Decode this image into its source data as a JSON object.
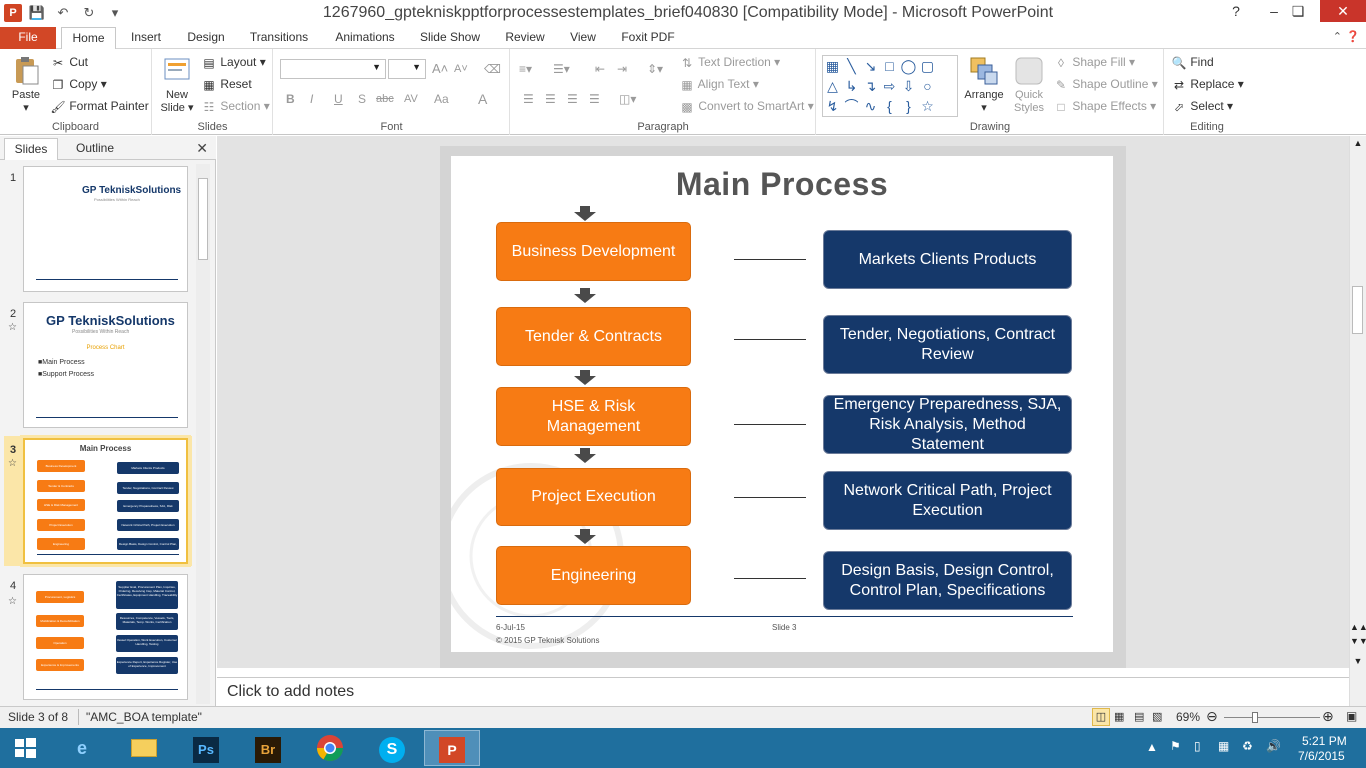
{
  "window": {
    "app_letter": "P",
    "title": "1267960_gpteknisk​pptforprocessestemplates_brief040830 [Compatibility Mode]  -  Microsoft PowerPoint",
    "help": "?",
    "minimize": "–",
    "restore": "❏",
    "close": "✕"
  },
  "tabs": [
    "File",
    "Home",
    "Insert",
    "Design",
    "Transitions",
    "Animations",
    "Slide Show",
    "Review",
    "View",
    "Foxit PDF"
  ],
  "ribbon": {
    "clipboard": {
      "label": "Clipboard",
      "paste": "Paste",
      "cut": "Cut",
      "copy": "Copy",
      "format_painter": "Format Painter"
    },
    "slides": {
      "label": "Slides",
      "new_slide_1": "New",
      "new_slide_2": "Slide",
      "layout": "Layout",
      "reset": "Reset",
      "section": "Section"
    },
    "font": {
      "label": "Font",
      "bold": "B",
      "italic": "I",
      "underline": "U",
      "strike": "S",
      "shadow": "abc",
      "spacing": "AV",
      "case": "Aa",
      "color": "A",
      "grow": "A˄",
      "shrink": "A˅"
    },
    "paragraph": {
      "label": "Paragraph",
      "text_direction": "Text Direction",
      "align_text": "Align Text",
      "smartart": "Convert to SmartArt"
    },
    "drawing": {
      "label": "Drawing",
      "arrange": "Arrange",
      "quick_styles_1": "Quick",
      "quick_styles_2": "Styles",
      "shape_fill": "Shape Fill",
      "shape_outline": "Shape Outline",
      "shape_effects": "Shape Effects"
    },
    "editing": {
      "label": "Editing",
      "find": "Find",
      "replace": "Replace",
      "select": "Select"
    }
  },
  "left_pane": {
    "tab_slides": "Slides",
    "tab_outline": "Outline",
    "close": "✕",
    "slide_numbers": [
      "1",
      "2",
      "3",
      "4"
    ],
    "thumb1": {
      "brand_gp": "GP",
      "brand_name": "TekniskSolutions",
      "tagline": "Possibilities Within Reach"
    },
    "thumb2": {
      "brand_gp": "GP",
      "brand_name": "TekniskSolutions",
      "tagline": "Possibilities Within Reach",
      "heading": "Process Chart",
      "items": [
        "Main Process",
        "Support Process"
      ]
    },
    "thumb3": {
      "title": "Main Process",
      "left": [
        "Business Development",
        "Tender & Contracts",
        "HSE & Risk Management",
        "Project Execution",
        "Engineering"
      ],
      "right": [
        "Markets Clients Products",
        "Tender, Negotiations, Contract Review",
        "Emergency Preparedness, SJA, Risk Analysis, Method Statement",
        "Network Critical Path, Project Execution",
        "Design Basis, Design Control, Control Plan, Specifications"
      ]
    },
    "thumb4": {
      "left": [
        "Procurement, Logistics",
        "Mobilization & Demobilization",
        "Operation",
        "Experience & Improvements"
      ],
      "right": [
        "Supplier Eval, Procurement Plan, Inquiries, Ordering, Receiving Insp, Material Control, Certificates, Equipment Handling, Traceability",
        "Resources, Competence, Vessels, Tools, Materials, Temp. Works, Certification",
        "Vessel Operation, Work Execution, Customer Handling, Testing",
        "Experience Report, Experience Register, Use of Experience, Improvement"
      ]
    }
  },
  "slide": {
    "title": "Main Process",
    "left_boxes": [
      "Business Development",
      "Tender & Contracts",
      "HSE & Risk Management",
      "Project Execution",
      "Engineering"
    ],
    "right_boxes": [
      "Markets Clients Products",
      "Tender, Negotiations, Contract Review",
      "Emergency Preparedness, SJA, Risk Analysis, Method Statement",
      "Network Critical Path, Project Execution",
      "Design Basis, Design Control, Control Plan, Specifications"
    ],
    "footer_date": "6-Jul-15",
    "footer_slide": "Slide  3",
    "footer_copyright": "© 2015  GP Teknisk  Solutions"
  },
  "notes_placeholder": "Click to add notes",
  "status": {
    "slide_of": "Slide 3 of 8",
    "template": "\"AMC_BOA template\"",
    "zoom": "69%"
  },
  "taskbar": {
    "apps": [
      "IE",
      "Explorer",
      "Ps",
      "Br",
      "Chrome",
      "Skype",
      "PowerPoint"
    ],
    "time": "5:21 PM",
    "date": "7/6/2015"
  },
  "colors": {
    "orange": "#f77b14",
    "navy": "#15386a",
    "file_tab": "#d24726",
    "taskbar": "#1f6f9e"
  }
}
